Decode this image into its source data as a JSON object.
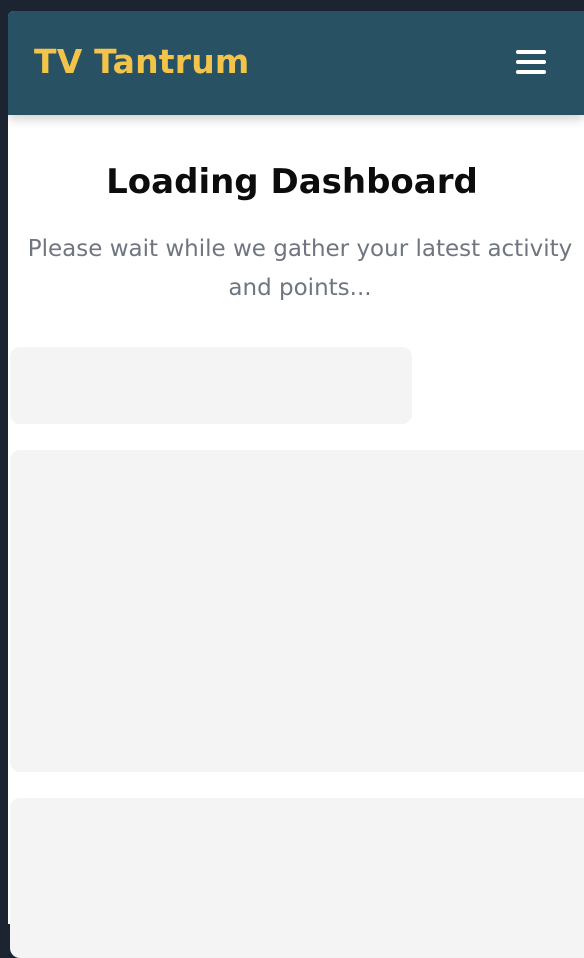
{
  "header": {
    "brand": "TV Tantrum",
    "menu_icon": "hamburger-menu-icon"
  },
  "main": {
    "title": "Loading Dashboard",
    "subtitle": "Please wait while we gather your latest activity and points..."
  },
  "colors": {
    "navbar_bg": "#285264",
    "brand_text": "#f3c44a",
    "skeleton": "#f4f4f4"
  }
}
